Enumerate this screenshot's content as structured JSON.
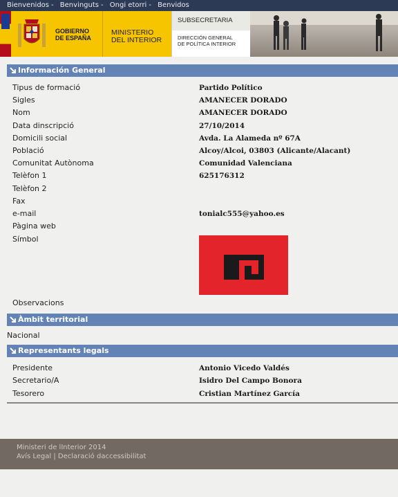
{
  "topnav": {
    "items": [
      "Bienvenidos",
      "Benvinguts",
      "Ongi etorri",
      "Benvidos"
    ],
    "separator": "-"
  },
  "header": {
    "gobierno": [
      "GOBIERNO",
      "DE ESPAÑA"
    ],
    "ministerio": [
      "MINISTERIO",
      "DEL INTERIOR"
    ],
    "subsecretaria": "SUBSECRETARIA",
    "direccion": [
      "DIRECCIÓN GENERAL",
      "DE POLÍTICA INTERIOR"
    ]
  },
  "sections": {
    "info_general": "Información General",
    "ambit": "Àmbit territorial",
    "representants": "Representants legals"
  },
  "info": [
    {
      "label": "Tipus de formació",
      "value": "Partido Político"
    },
    {
      "label": "Sigles",
      "value": "AMANECER DORADO"
    },
    {
      "label": "Nom",
      "value": "AMANECER DORADO"
    },
    {
      "label": "Data dinscripció",
      "value": "27/10/2014"
    },
    {
      "label": "Domicili social",
      "value": "Avda. La Alameda nº 67A"
    },
    {
      "label": "Població",
      "value": "Alcoy/Alcoi, 03803 (Alicante/Alacant)"
    },
    {
      "label": "Comunitat Autònoma",
      "value": "Comunidad Valenciana"
    },
    {
      "label": "Telèfon 1",
      "value": "625176312"
    },
    {
      "label": "Telèfon 2",
      "value": ""
    },
    {
      "label": "Fax",
      "value": ""
    },
    {
      "label": "e-mail",
      "value": "tonialc555@yahoo.es"
    },
    {
      "label": "Pàgina web",
      "value": ""
    },
    {
      "label": "Símbol",
      "value": ""
    }
  ],
  "observacions_label": "Observacions",
  "ambit_value": "Nacional",
  "representants": [
    {
      "label": "Presidente",
      "value": "Antonio Vicedo Valdés"
    },
    {
      "label": "Secretario/A",
      "value": "Isidro Del Campo Bonora"
    },
    {
      "label": "Tesorero",
      "value": "Cristian Martínez García"
    }
  ],
  "footer": {
    "copyright": "Ministeri de lInterior 2014",
    "legal": "Avís Legal",
    "separator": "|",
    "accessibility": "Declaració daccessibilitat"
  },
  "colors": {
    "section_bar": "#6383b6",
    "topnav": "#2d3a55",
    "footer": "#726a62",
    "symbol_red": "#e3242b",
    "yellow": "#f6c500"
  }
}
